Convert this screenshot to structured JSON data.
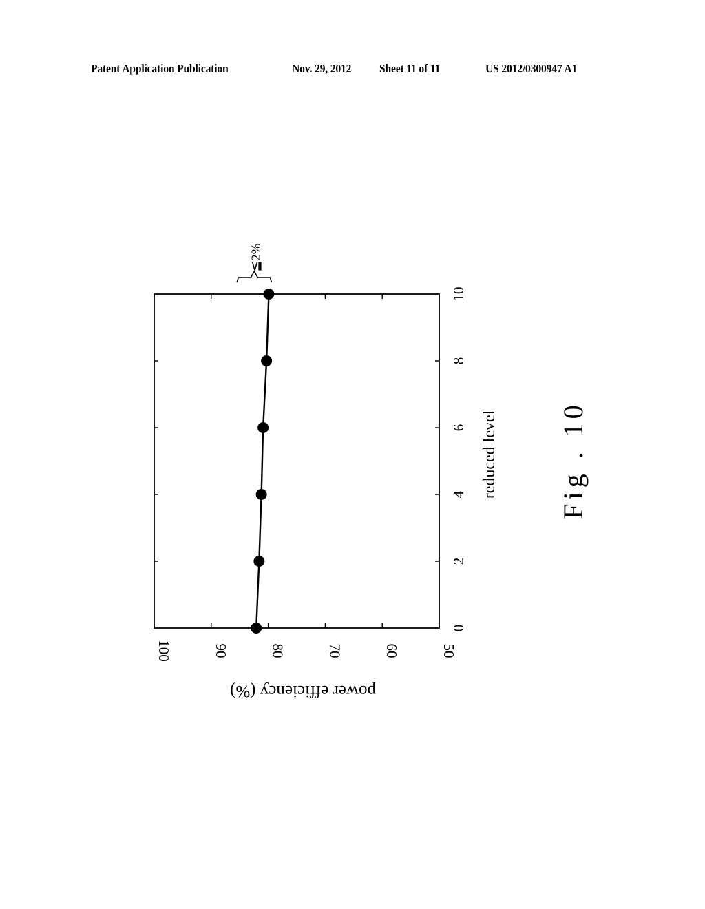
{
  "header": {
    "publication": "Patent Application Publication",
    "date": "Nov. 29, 2012",
    "sheet": "Sheet 11 of 11",
    "number": "US 2012/0300947 A1"
  },
  "figure": {
    "caption": "Fig . 10",
    "orientation": "rotated 90° clockwise",
    "annotation": "≦2%"
  },
  "chart_data": {
    "type": "line",
    "title": "",
    "xlabel": "reduced level",
    "ylabel": "power efficiency (%)",
    "x": [
      0,
      2,
      4,
      6,
      8,
      10
    ],
    "x_ticks": [
      "0",
      "2",
      "4",
      "6",
      "8",
      "10"
    ],
    "xlim": [
      0,
      10
    ],
    "y_ticks": [
      "100",
      "90",
      "80",
      "70",
      "60",
      "50"
    ],
    "ylim": [
      50,
      100
    ],
    "series": [
      {
        "name": "power efficiency",
        "marker": "filled-circle",
        "values": [
          82.1,
          81.6,
          81.2,
          80.9,
          80.3,
          79.9
        ]
      }
    ],
    "grid": false,
    "legend": "none",
    "annotations": [
      {
        "text": "≦2%",
        "target": "spread between level 0 and level 10 efficiency",
        "placement": "above level 10 (brace)"
      }
    ]
  }
}
